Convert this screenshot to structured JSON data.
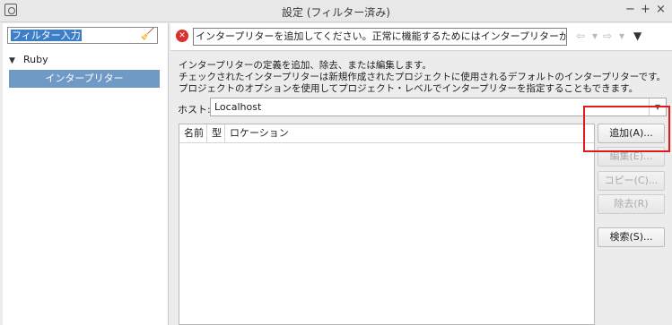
{
  "window": {
    "title": "設定 (フィルター済み)",
    "controls": [
      "−",
      "+",
      "×"
    ]
  },
  "sidebar": {
    "filter_text": "フィルター入力",
    "tree": [
      {
        "label": "Ruby",
        "expanded": true
      },
      {
        "label": "インタープリター",
        "selected": true
      }
    ]
  },
  "message": {
    "text": "インタープリターを追加してください。正常に機能するためにはインタープリターが必要です。",
    "nav": {
      "back": "⇦",
      "back_menu": "▾",
      "forward": "⇨",
      "forward_menu": "▾",
      "view_menu": "▼"
    }
  },
  "description": [
    "インタープリターの定義を追加、除去、または編集します。",
    "チェックされたインタープリターは新規作成されたプロジェクトに使用されるデフォルトのインタープリターです。",
    "プロジェクトのオプションを使用してプロジェクト・レベルでインタープリターを指定することもできます。"
  ],
  "host": {
    "label": "ホスト:",
    "value": "Localhost"
  },
  "table": {
    "columns": [
      "名前",
      "型",
      "ロケーション"
    ],
    "rows": []
  },
  "buttons": {
    "add": "追加(A)...",
    "edit": "編集(E)...",
    "copy": "コピー(C)...",
    "remove": "除去(R)",
    "search": "検索(S)..."
  },
  "colors": {
    "selection": "#6f9ac6",
    "error": "#d9312c",
    "highlight_box": "#e01b1b"
  }
}
